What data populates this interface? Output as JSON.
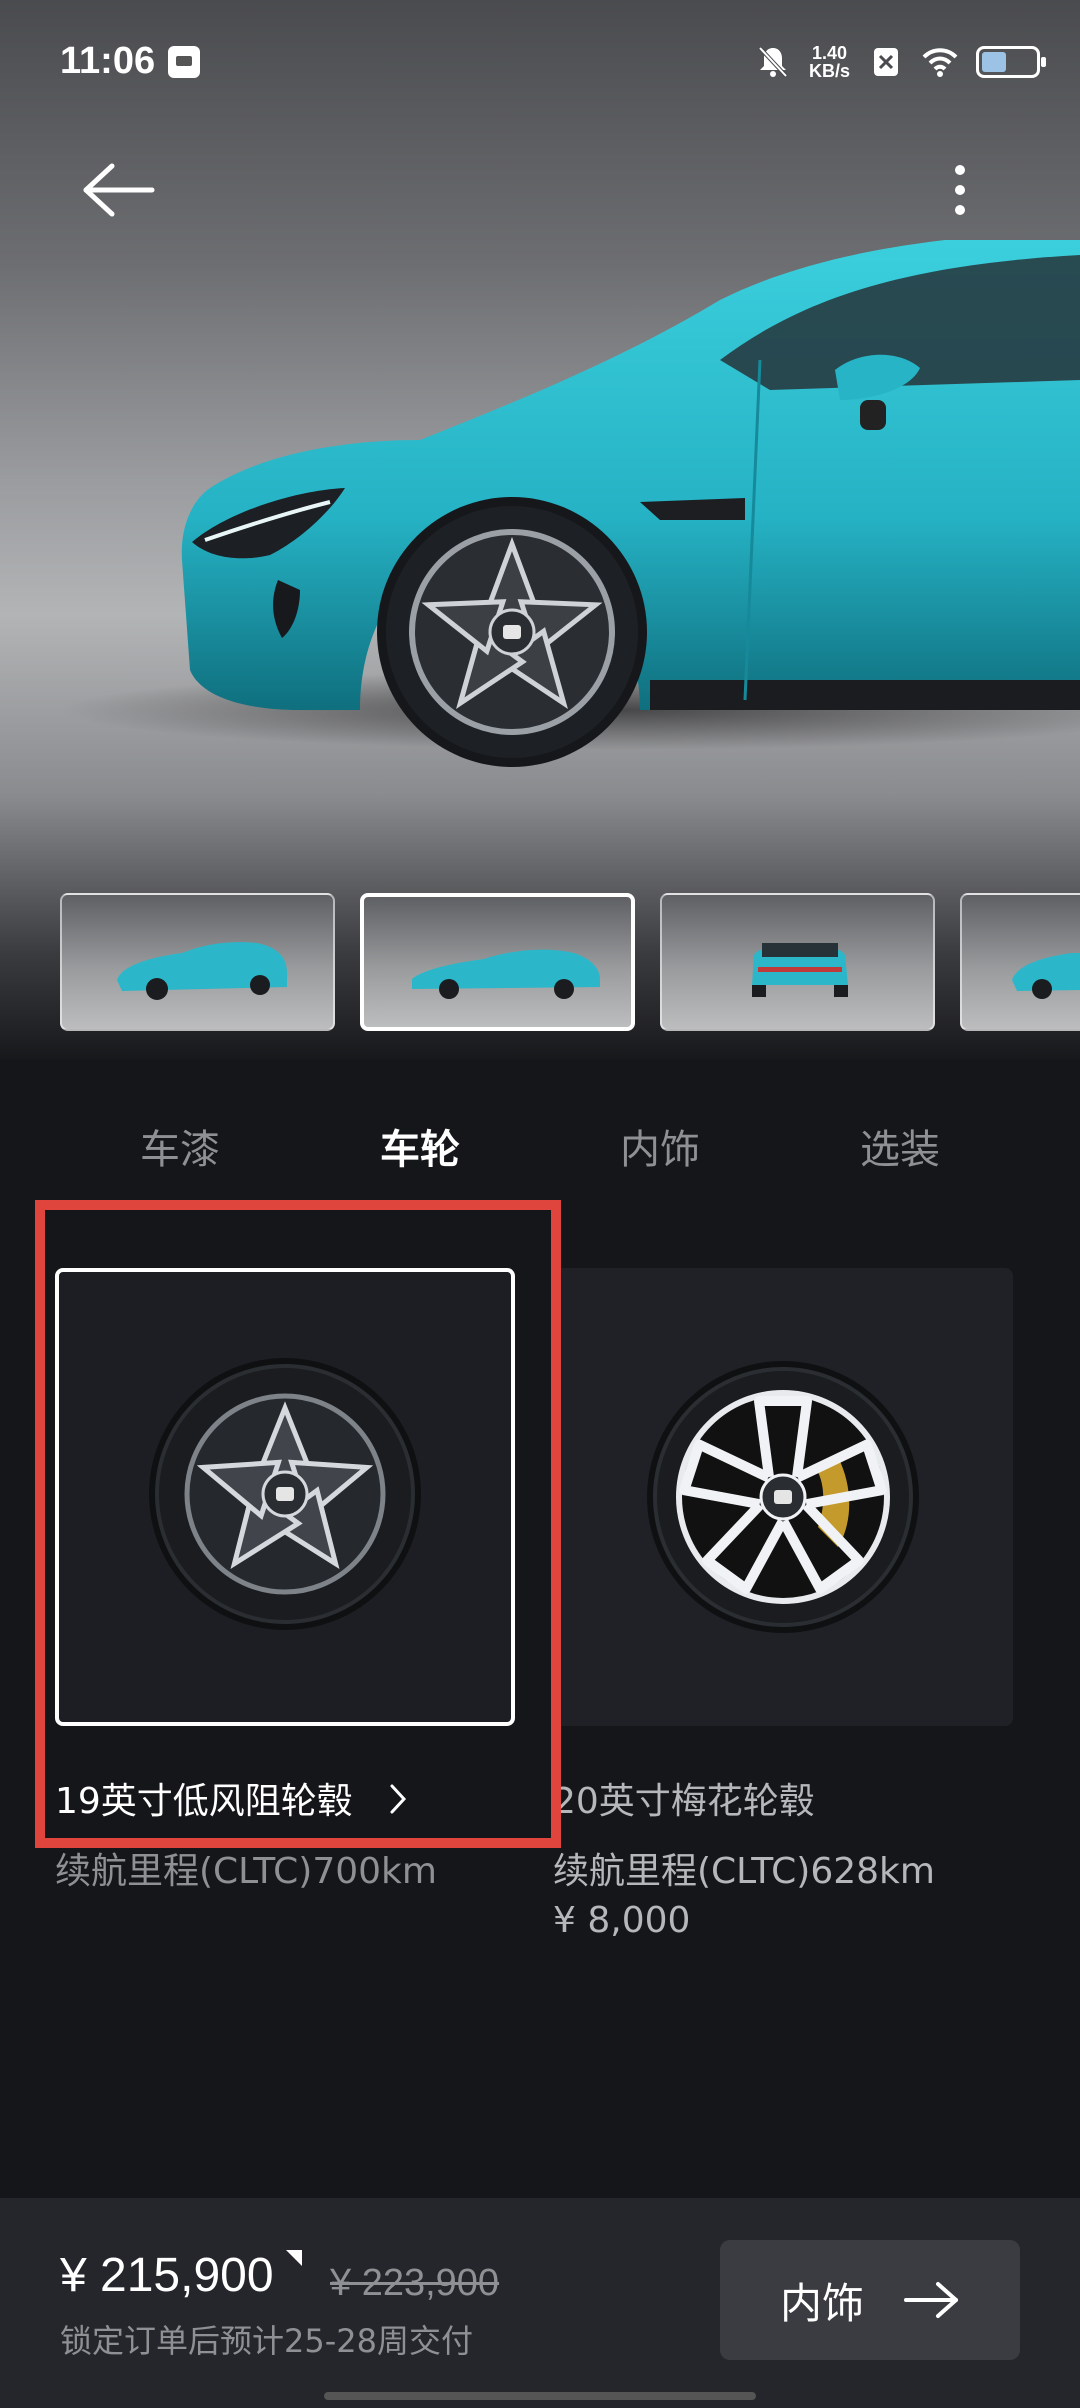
{
  "status": {
    "time": "11:06",
    "net_speed_value": "1.40",
    "net_speed_unit": "KB/s"
  },
  "tabs": [
    {
      "label": "车漆",
      "active": false
    },
    {
      "label": "车轮",
      "active": true
    },
    {
      "label": "内饰",
      "active": false
    },
    {
      "label": "选装",
      "active": false
    }
  ],
  "options": [
    {
      "title": "19英寸低风阻轮毂",
      "range": "续航里程(CLTC)700km",
      "price": "",
      "selected": true
    },
    {
      "title": "20英寸梅花轮毂",
      "range": "续航里程(CLTC)628km",
      "price": "¥ 8,000",
      "selected": false
    }
  ],
  "footer": {
    "price": "¥ 215,900",
    "old_price": "¥ 223,900",
    "delivery": "锁定订单后预计25-28周交付",
    "next_label": "内饰"
  },
  "colors": {
    "car_body": "#2bb7c9",
    "highlight": "#e0453d",
    "background": "#14161a"
  },
  "icons": {
    "back": "arrow-left-icon",
    "more": "more-vertical-icon",
    "next": "arrow-right-icon",
    "chevron": "chevron-right-icon"
  }
}
